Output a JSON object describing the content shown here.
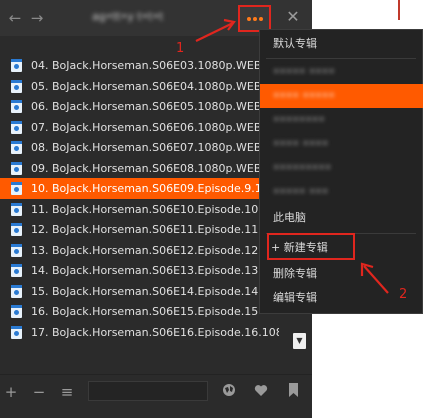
{
  "window": {
    "title": "ag•tt•y t•t•t"
  },
  "titlebar": {
    "back_icon": "back-icon",
    "forward_icon": "forward-icon",
    "more_icon": "more-dots-icon",
    "close_icon": "close-icon"
  },
  "playlist": {
    "items": [
      {
        "label": "04. BoJack.Horseman.S06E03.1080p.WEB",
        "active": false
      },
      {
        "label": "05. BoJack.Horseman.S06E04.1080p.WEB",
        "active": false
      },
      {
        "label": "06. BoJack.Horseman.S06E05.1080p.WEB",
        "active": false
      },
      {
        "label": "07. BoJack.Horseman.S06E06.1080p.WEB",
        "active": false
      },
      {
        "label": "08. BoJack.Horseman.S06E07.1080p.WEB",
        "active": false
      },
      {
        "label": "09. BoJack.Horseman.S06E08.1080p.WEB",
        "active": false
      },
      {
        "label": "10. BoJack.Horseman.S06E09.Episode.9.1",
        "active": true
      },
      {
        "label": "11. BoJack.Horseman.S06E10.Episode.10",
        "active": false
      },
      {
        "label": "12. BoJack.Horseman.S06E11.Episode.11",
        "active": false
      },
      {
        "label": "13. BoJack.Horseman.S06E12.Episode.12",
        "active": false
      },
      {
        "label": "14. BoJack.Horseman.S06E13.Episode.13",
        "active": false
      },
      {
        "label": "15. BoJack.Horseman.S06E14.Episode.14",
        "active": false
      },
      {
        "label": "16. BoJack.Horseman.S06E15.Episode.15",
        "active": false
      },
      {
        "label": "17. BoJack.Horseman.S06E16.Episode.16.1080...",
        "active": false
      }
    ]
  },
  "menu": {
    "default_album": "默认专辑",
    "blurred_items": [
      {
        "label": "••••• ••••",
        "highlight": false
      },
      {
        "label": "•••• •••••",
        "highlight": true
      },
      {
        "label": "••••••••",
        "highlight": false
      },
      {
        "label": "•••• ••••",
        "highlight": false
      },
      {
        "label": "•••••••••",
        "highlight": false
      },
      {
        "label": "••••• •••",
        "highlight": false
      }
    ],
    "this_pc": "此电脑",
    "new_album": "+ 新建专辑",
    "delete_album": "删除专辑",
    "edit_album": "编辑专辑"
  },
  "toolbar": {
    "add_icon": "plus-icon",
    "remove_icon": "minus-icon",
    "checklist_icon": "checklist-icon",
    "globe_icon": "globe-icon",
    "heart_icon": "heart-icon",
    "bookmark_icon": "bookmark-icon"
  },
  "annotations": {
    "step1": "1",
    "step2": "2"
  },
  "colors": {
    "accent": "#ff5a00",
    "annotation_red": "#e0261e",
    "file_icon_blue": "#2a7ad2"
  }
}
